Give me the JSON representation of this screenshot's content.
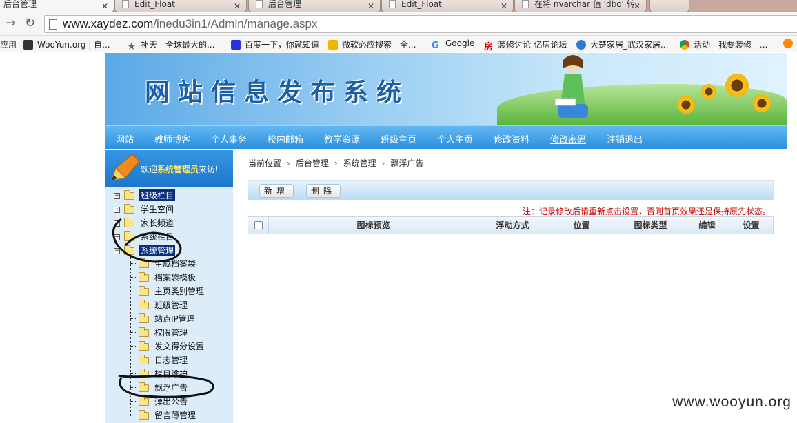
{
  "browser": {
    "tabs": [
      {
        "title": "后台管理",
        "active": true
      },
      {
        "title": "Edit_Float",
        "active": false
      },
      {
        "title": "后台管理",
        "active": false
      },
      {
        "title": "Edit_Float",
        "active": false
      },
      {
        "title": "在将 nvarchar 值 'dbo' 转",
        "active": false
      }
    ],
    "url_host": "www.xaydez.com",
    "url_path": "/inedu3in1/Admin/manage.aspx",
    "bookmarks": [
      {
        "label": "应用",
        "icon": "apps-icon",
        "color": ""
      },
      {
        "label": "WooYun.org | 自...",
        "icon": "wooyun-icon",
        "color": "#333333"
      },
      {
        "label": "补天 - 全球最大的...",
        "icon": "star-icon",
        "color": "#888888"
      },
      {
        "label": "百度一下，你就知道",
        "icon": "baidu-icon",
        "color": "#2932e1"
      },
      {
        "label": "微软必应搜索 - 全...",
        "icon": "bing-icon",
        "color": "#f2b600"
      },
      {
        "label": "Google",
        "icon": "google-icon",
        "color": "#4285f4"
      },
      {
        "label": "装修讨论-亿房论坛",
        "icon": "fang-icon",
        "color": "#cc0000"
      },
      {
        "label": "大楚家居_武汉家居...",
        "icon": "ie-icon",
        "color": "#2a7bd6"
      },
      {
        "label": "活动 - 我要装修 - ...",
        "icon": "chrome-icon",
        "color": "#3aa757"
      }
    ]
  },
  "banner": {
    "title": "网站信息发布系统"
  },
  "nav": [
    "网站",
    "教师博客",
    "个人事务",
    "校内邮箱",
    "教学资源",
    "班级主页",
    "个人主页",
    "修改资料",
    "修改密码",
    "注销退出"
  ],
  "sidebar": {
    "welcome_prefix": "欢迎",
    "welcome_role": "系统管理员",
    "welcome_suffix": "来访!",
    "top_items": [
      "班级栏目",
      "学生空间",
      "家长频道",
      "系统栏目",
      "系统管理"
    ],
    "children": [
      "生成档案袋",
      "档案袋模板",
      "主页类别管理",
      "班级管理",
      "站点IP管理",
      "权限管理",
      "发文得分设置",
      "日志管理",
      "栏目维护",
      "飘浮广告",
      "弹出公告",
      "留言薄管理"
    ]
  },
  "breadcrumb": [
    "当前位置",
    "后台管理",
    "系统管理",
    "飘浮广告"
  ],
  "actions": {
    "add": "新增",
    "delete": "删除"
  },
  "note": "注：记录修改后请重新点击设置，否则首页效果还是保持原先状态。",
  "table": {
    "headers": [
      "图标预览",
      "浮动方式",
      "位置",
      "图标类型",
      "编辑",
      "设置"
    ]
  },
  "watermark": "www.wooyun.org"
}
